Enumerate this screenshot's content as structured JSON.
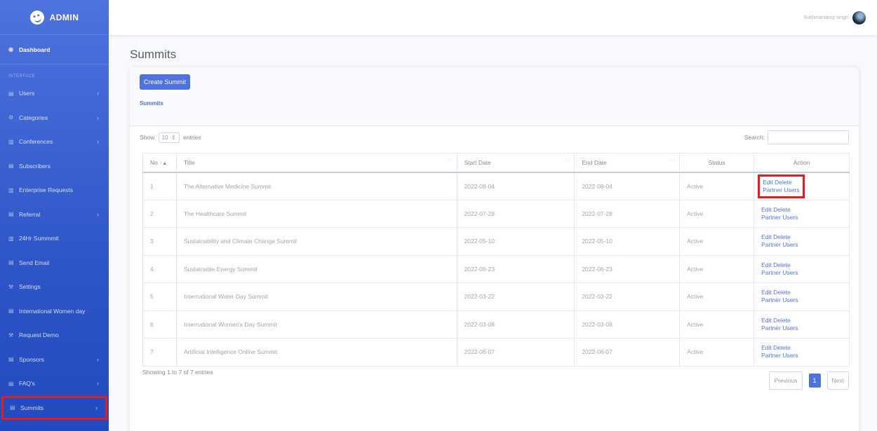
{
  "app": {
    "brand": "ADMIN"
  },
  "topbar": {
    "username": "Sukhmandeep singh"
  },
  "sidebar": {
    "dashboard": "Dashboard",
    "heading": "INTERFACE",
    "items": [
      {
        "label": "Users",
        "icon": "table-icon",
        "chevron": true
      },
      {
        "label": "Categories",
        "icon": "gear-icon",
        "chevron": true
      },
      {
        "label": "Conferences",
        "icon": "chart-icon",
        "chevron": true
      },
      {
        "label": "Subscribers",
        "icon": "table-icon",
        "chevron": false
      },
      {
        "label": "Enterprise Requests",
        "icon": "chart-icon",
        "chevron": false
      },
      {
        "label": "Referral",
        "icon": "table-icon",
        "chevron": true
      },
      {
        "label": "24Hr Summmit",
        "icon": "chart-icon",
        "chevron": false
      },
      {
        "label": "Send Email",
        "icon": "table-icon",
        "chevron": false
      },
      {
        "label": "Settings",
        "icon": "wrench-icon",
        "chevron": false
      },
      {
        "label": "International Women day",
        "icon": "table-icon",
        "chevron": false
      },
      {
        "label": "Request Demo",
        "icon": "wrench-icon",
        "chevron": false
      },
      {
        "label": "Sponsors",
        "icon": "table-icon",
        "chevron": true
      },
      {
        "label": "FAQ's",
        "icon": "table-icon",
        "chevron": true
      },
      {
        "label": "Summits",
        "icon": "table-icon",
        "chevron": true
      }
    ]
  },
  "page": {
    "title": "Summits",
    "create_button": "Create Summit",
    "card_subtitle": "Summits"
  },
  "table_controls": {
    "show_label": "Show",
    "entries_value": "10",
    "entries_label": "entries",
    "search_label": "Search:"
  },
  "table": {
    "headers": [
      "No",
      "Title",
      "Start Date",
      "End Date",
      "Status",
      "Action"
    ],
    "rows": [
      {
        "no": "1",
        "title": "The Alternative Medicine Summit",
        "start": "2022-08-04",
        "end": "2022-08-04",
        "status": "Active"
      },
      {
        "no": "2",
        "title": "The Healthcare Summit",
        "start": "2022-07-28",
        "end": "2022-07-28",
        "status": "Active"
      },
      {
        "no": "3",
        "title": "Sustainability and Climate Change Summit",
        "start": "2022-05-10",
        "end": "2022-05-10",
        "status": "Active"
      },
      {
        "no": "4",
        "title": "Sustainable Energy Summit",
        "start": "2022-06-23",
        "end": "2022-06-23",
        "status": "Active"
      },
      {
        "no": "5",
        "title": "International Water Day Summit",
        "start": "2022-03-22",
        "end": "2022-03-22",
        "status": "Active"
      },
      {
        "no": "6",
        "title": "International Women's Day Summit",
        "start": "2022-03-08",
        "end": "2022-03-08",
        "status": "Active"
      },
      {
        "no": "7",
        "title": "Artificial Intelligence Online Summit",
        "start": "2022-06-07",
        "end": "2022-06-07",
        "status": "Active"
      }
    ],
    "actions": {
      "edit": "Edit",
      "delete": "Delete",
      "partner": "Partner Users"
    }
  },
  "footer": {
    "info": "Showing 1 to 7 of 7 entries",
    "previous": "Previous",
    "page": "1",
    "next": "Next"
  },
  "colors": {
    "primary": "#4e73df",
    "highlight": "#e11d1d",
    "sidebar_dark": "#224abe"
  }
}
